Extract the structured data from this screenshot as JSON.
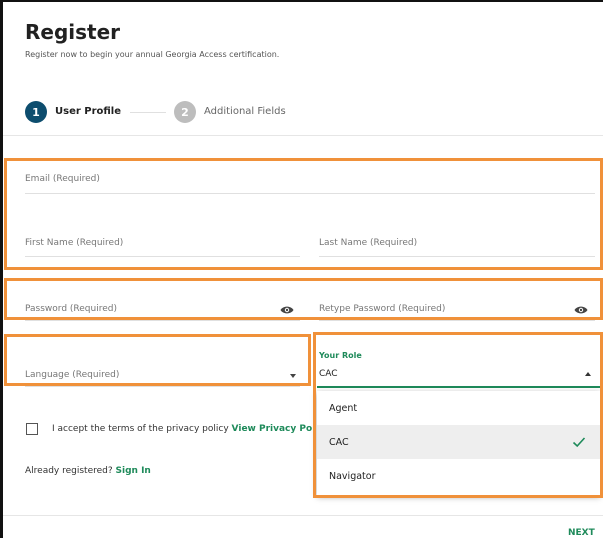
{
  "header": {
    "title": "Register",
    "subtitle": "Register now to begin your annual Georgia Access certification."
  },
  "stepper": {
    "steps": [
      {
        "number": "1",
        "label": "User Profile",
        "active": true
      },
      {
        "number": "2",
        "label": "Additional Fields",
        "active": false
      }
    ]
  },
  "form": {
    "email_label": "Email  (Required)",
    "first_name_label": "First Name  (Required)",
    "last_name_label": "Last Name  (Required)",
    "password_label": "Password (Required)",
    "retype_password_label": "Retype Password (Required)",
    "language_label": "Language (Required)",
    "role": {
      "label": "Your Role",
      "value": "CAC",
      "options": [
        "Agent",
        "CAC",
        "Navigator"
      ],
      "selected_index": 1
    },
    "terms": {
      "text": "I accept the terms of the privacy policy ",
      "link": "View Privacy Po",
      "checked": false
    }
  },
  "signin": {
    "prompt": "Already registered? ",
    "link": "Sign In"
  },
  "footer": {
    "next_label": "NEXT"
  },
  "colors": {
    "accent": "#1e8a5a",
    "step_active": "#0d4d6e",
    "highlight": "#f0913a"
  }
}
